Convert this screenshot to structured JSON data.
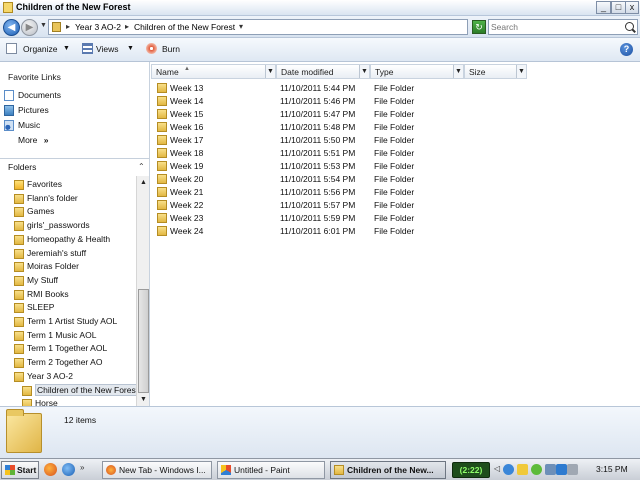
{
  "window": {
    "title": "Children of the New Forest",
    "buttons": {
      "minimize": "_",
      "maximize": "□",
      "close": "x"
    }
  },
  "address": {
    "breadcrumbs": [
      "Year 3 AO-2",
      "Children of the New Forest"
    ],
    "search_placeholder": "Search"
  },
  "toolbar": {
    "organize": "Organize",
    "views": "Views",
    "burn": "Burn"
  },
  "nav": {
    "favorite_links_heading": "Favorite Links",
    "favorites": [
      "Documents",
      "Pictures",
      "Music"
    ],
    "more_label": "More",
    "folders_label": "Folders",
    "tree": [
      {
        "label": "Favorites",
        "icon": "favorites-star-icon"
      },
      {
        "label": "Flann's folder",
        "icon": "folder-icon"
      },
      {
        "label": "Games",
        "icon": "folder-icon"
      },
      {
        "label": "girls'_passwords",
        "icon": "folder-icon"
      },
      {
        "label": "Homeopathy & Health",
        "icon": "folder-icon"
      },
      {
        "label": "Jeremiah's stuff",
        "icon": "folder-icon"
      },
      {
        "label": "Moiras Folder",
        "icon": "folder-icon"
      },
      {
        "label": "My Stuff",
        "icon": "folder-icon"
      },
      {
        "label": "RMI Books",
        "icon": "folder-icon"
      },
      {
        "label": "SLEEP",
        "icon": "folder-icon"
      },
      {
        "label": "Term 1 Artist Study AOL",
        "icon": "folder-icon"
      },
      {
        "label": "Term 1 Music AOL",
        "icon": "folder-icon"
      },
      {
        "label": "Term 1 Together AOL",
        "icon": "folder-icon"
      },
      {
        "label": "Term 2 Together AO",
        "icon": "folder-icon"
      },
      {
        "label": "Year 3 AO-2",
        "icon": "folder-icon"
      },
      {
        "label": "Children of the New Forest",
        "icon": "folder-icon",
        "selected": true
      },
      {
        "label": "Horse",
        "icon": "folder-icon"
      }
    ]
  },
  "columns": {
    "name": "Name",
    "date_modified": "Date modified",
    "type": "Type",
    "size": "Size"
  },
  "files": [
    {
      "name": "Week 13",
      "date": "11/10/2011 5:44 PM",
      "type": "File Folder"
    },
    {
      "name": "Week 14",
      "date": "11/10/2011 5:46 PM",
      "type": "File Folder"
    },
    {
      "name": "Week 15",
      "date": "11/10/2011 5:47 PM",
      "type": "File Folder"
    },
    {
      "name": "Week 16",
      "date": "11/10/2011 5:48 PM",
      "type": "File Folder"
    },
    {
      "name": "Week 17",
      "date": "11/10/2011 5:50 PM",
      "type": "File Folder"
    },
    {
      "name": "Week 18",
      "date": "11/10/2011 5:51 PM",
      "type": "File Folder"
    },
    {
      "name": "Week 19",
      "date": "11/10/2011 5:53 PM",
      "type": "File Folder"
    },
    {
      "name": "Week 20",
      "date": "11/10/2011 5:54 PM",
      "type": "File Folder"
    },
    {
      "name": "Week 21",
      "date": "11/10/2011 5:56 PM",
      "type": "File Folder"
    },
    {
      "name": "Week 22",
      "date": "11/10/2011 5:57 PM",
      "type": "File Folder"
    },
    {
      "name": "Week 23",
      "date": "11/10/2011 5:59 PM",
      "type": "File Folder"
    },
    {
      "name": "Week 24",
      "date": "11/10/2011 6:01 PM",
      "type": "File Folder"
    }
  ],
  "details": {
    "item_count": "12 items"
  },
  "taskbar": {
    "start": "Start",
    "tasks": [
      {
        "label": "New Tab - Windows I...",
        "icon": "firefox-icon"
      },
      {
        "label": "Untitled - Paint",
        "icon": "paint-icon"
      },
      {
        "label": "Children of the New...",
        "icon": "folder-icon",
        "active": true
      }
    ],
    "battery": "(2:22)",
    "clock": "3:15 PM"
  },
  "colors": {
    "titlebar": "#d9e4f1",
    "selection": "#e3e8ee",
    "folder": "#e2b843",
    "taskbar": "#c9ced6"
  }
}
